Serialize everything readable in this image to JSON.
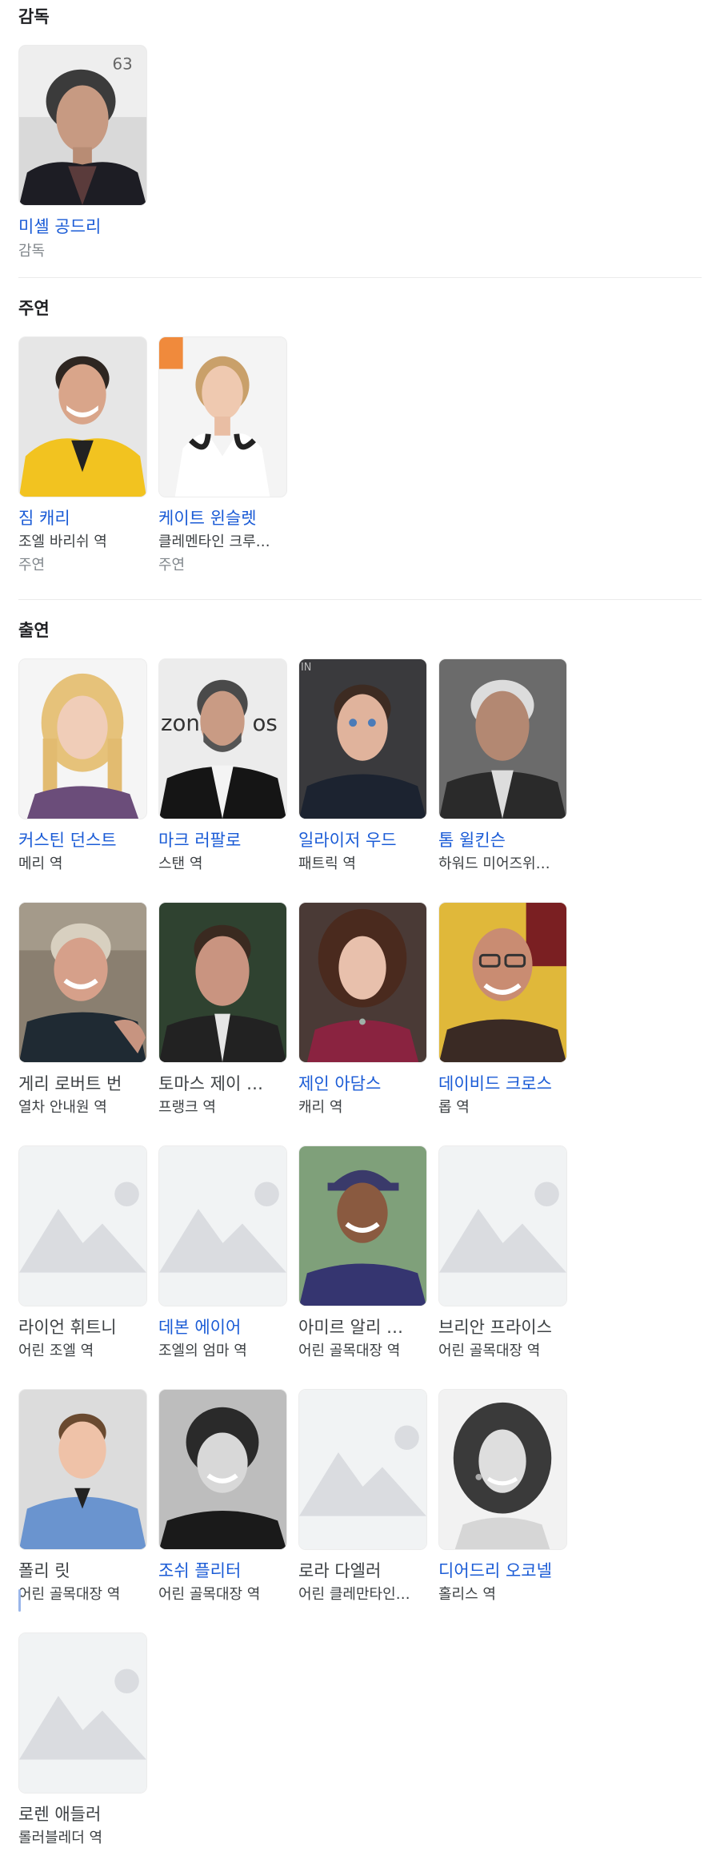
{
  "director_section": {
    "title": "감독",
    "people": [
      {
        "name": "미셸 공드리",
        "kind": "감독",
        "link": true,
        "photo": "director-man"
      }
    ]
  },
  "lead_section": {
    "title": "주연",
    "people": [
      {
        "name": "짐 캐리",
        "role": "조엘 바리쉬 역",
        "kind": "주연",
        "link": true,
        "photo": "yellow-jacket-man"
      },
      {
        "name": "케이트 윈슬렛",
        "role": "클레멘타인 크루…",
        "kind": "주연",
        "link": true,
        "photo": "blonde-woman-white"
      }
    ]
  },
  "cast_section": {
    "title": "출연",
    "people": [
      {
        "name": "커스틴 던스트",
        "role": "메리 역",
        "link": true,
        "photo": "blonde-woman"
      },
      {
        "name": "마크 러팔로",
        "role": "스탠 역",
        "link": true,
        "photo": "bearded-man-suit"
      },
      {
        "name": "일라이저 우드",
        "role": "패트릭 역",
        "link": true,
        "photo": "young-man-dark"
      },
      {
        "name": "톰 윌킨슨",
        "role": "하워드 미어즈위…",
        "link": true,
        "photo": "older-man"
      },
      {
        "name": "게리 로버트 번",
        "role": "열차 안내원 역",
        "link": false,
        "photo": "smiling-man-outdoor"
      },
      {
        "name": "토마스 제이 …",
        "role": "프랭크 역",
        "link": false,
        "photo": "man-suit-tie"
      },
      {
        "name": "제인 아담스",
        "role": "캐리 역",
        "link": true,
        "photo": "curly-woman"
      },
      {
        "name": "데이비드 크로스",
        "role": "롭 역",
        "link": true,
        "photo": "glasses-man"
      },
      {
        "name": "라이언 휘트니",
        "role": "어린 조엘 역",
        "link": false,
        "photo": "placeholder"
      },
      {
        "name": "데본 에이어",
        "role": "조엘의 엄마 역",
        "link": true,
        "photo": "placeholder"
      },
      {
        "name": "아미르 알리 …",
        "role": "어린 골목대장 역",
        "link": false,
        "photo": "boy-cap"
      },
      {
        "name": "브리안 프라이스",
        "role": "어린 골목대장 역",
        "link": false,
        "photo": "placeholder"
      },
      {
        "name": "폴리 릿",
        "role": "어린 골목대장 역",
        "link": false,
        "photo": "boy-blue-shirt"
      },
      {
        "name": "조쉬 플리터",
        "role": "어린 골목대장 역",
        "link": true,
        "photo": "boy-bw"
      },
      {
        "name": "로라 다엘러",
        "role": "어린 클레만타인…",
        "link": false,
        "photo": "placeholder"
      },
      {
        "name": "디어드리 오코넬",
        "role": "홀리스 역",
        "link": true,
        "photo": "woman-bw-curly"
      },
      {
        "name": "로렌 애들러",
        "role": "롤러블레더 역",
        "link": false,
        "photo": "placeholder"
      }
    ]
  },
  "colors": {
    "link": "#1a5bd6",
    "text": "#3c4043",
    "muted": "#80868b",
    "placeholder_bg": "#f1f3f4",
    "placeholder_icon": "#dadce0"
  }
}
